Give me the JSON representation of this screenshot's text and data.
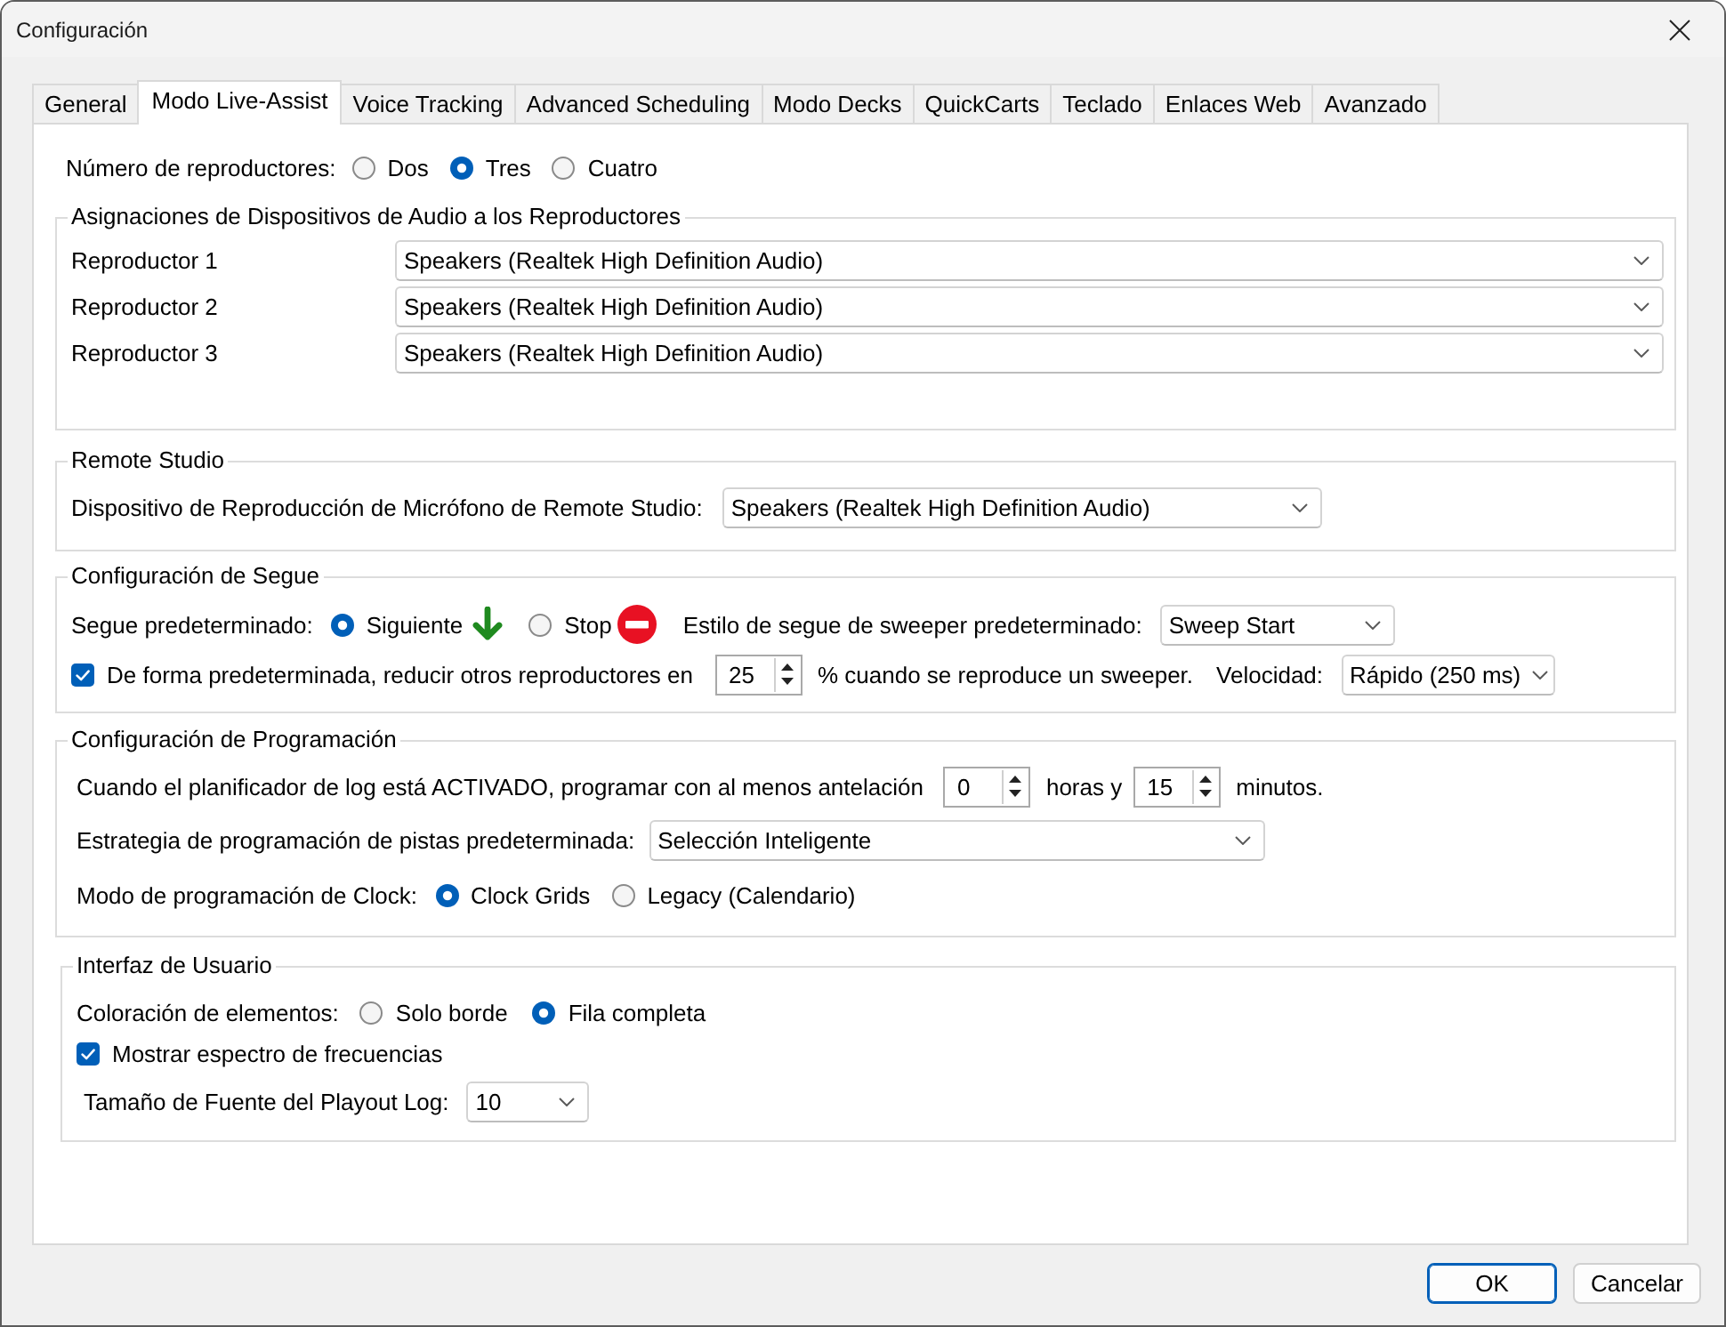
{
  "window": {
    "title": "Configuración"
  },
  "tabs": [
    {
      "label": "General",
      "selected": false
    },
    {
      "label": "Modo Live-Assist",
      "selected": true
    },
    {
      "label": "Voice Tracking",
      "selected": false
    },
    {
      "label": "Advanced Scheduling",
      "selected": false
    },
    {
      "label": "Modo Decks",
      "selected": false
    },
    {
      "label": "QuickCarts",
      "selected": false
    },
    {
      "label": "Teclado",
      "selected": false
    },
    {
      "label": "Enlaces Web",
      "selected": false
    },
    {
      "label": "Avanzado",
      "selected": false
    }
  ],
  "player_count": {
    "label": "Número de reproductores:",
    "options": [
      {
        "label": "Dos",
        "selected": false
      },
      {
        "label": "Tres",
        "selected": true
      },
      {
        "label": "Cuatro",
        "selected": false
      }
    ]
  },
  "audio_devices": {
    "title": "Asignaciones de Dispositivos de Audio a los Reproductores",
    "rows": [
      {
        "label": "Reproductor 1",
        "value": "Speakers (Realtek High Definition Audio)"
      },
      {
        "label": "Reproductor 2",
        "value": "Speakers (Realtek High Definition Audio)"
      },
      {
        "label": "Reproductor 3",
        "value": "Speakers (Realtek High Definition Audio)"
      }
    ]
  },
  "remote_studio": {
    "title": "Remote Studio",
    "label": "Dispositivo de Reproducción de Micrófono de Remote Studio:",
    "value": "Speakers (Realtek High Definition Audio)"
  },
  "segue": {
    "title": "Configuración de Segue",
    "label": "Segue predeterminado:",
    "modes": [
      {
        "label": "Siguiente",
        "kind": "next",
        "selected": true
      },
      {
        "label": "Stop",
        "kind": "stop",
        "selected": false
      }
    ],
    "sweeper_style": {
      "label": "Estilo de segue de sweeper predeterminado:",
      "value": "Sweep Start"
    },
    "duck": {
      "checked": true,
      "label": "De forma predeterminada, reducir otros reproductores en",
      "value": "25",
      "suffix": "% cuando se reproduce un sweeper."
    },
    "speed": {
      "label": "Velocidad:",
      "value": "Rápido (250 ms)"
    }
  },
  "scheduling": {
    "title": "Configuración de Programación",
    "lead": {
      "label": "Cuando el planificador de log está ACTIVADO, programar con al menos antelación",
      "hours": "0",
      "hours_label": "horas y",
      "minutes": "15",
      "minutes_label": "minutos."
    },
    "strategy": {
      "label": "Estrategia de programación de pistas predeterminada:",
      "value": "Selección Inteligente"
    },
    "clock_mode": {
      "label": "Modo de programación de Clock:",
      "options": [
        {
          "label": "Clock Grids",
          "selected": true
        },
        {
          "label": "Legacy (Calendario)",
          "selected": false
        }
      ]
    }
  },
  "user_interface": {
    "title": "Interfaz de Usuario",
    "coloring": {
      "label": "Coloración de elementos:",
      "options": [
        {
          "label": "Solo borde",
          "selected": false
        },
        {
          "label": "Fila completa",
          "selected": true
        }
      ]
    },
    "spectrum": {
      "checked": true,
      "label": "Mostrar espectro de frecuencias"
    },
    "font_size": {
      "label": "Tamaño de Fuente del Playout Log:",
      "value": "10"
    }
  },
  "buttons": [
    {
      "label": "OK",
      "default": true
    },
    {
      "label": "Cancelar",
      "default": false
    }
  ]
}
